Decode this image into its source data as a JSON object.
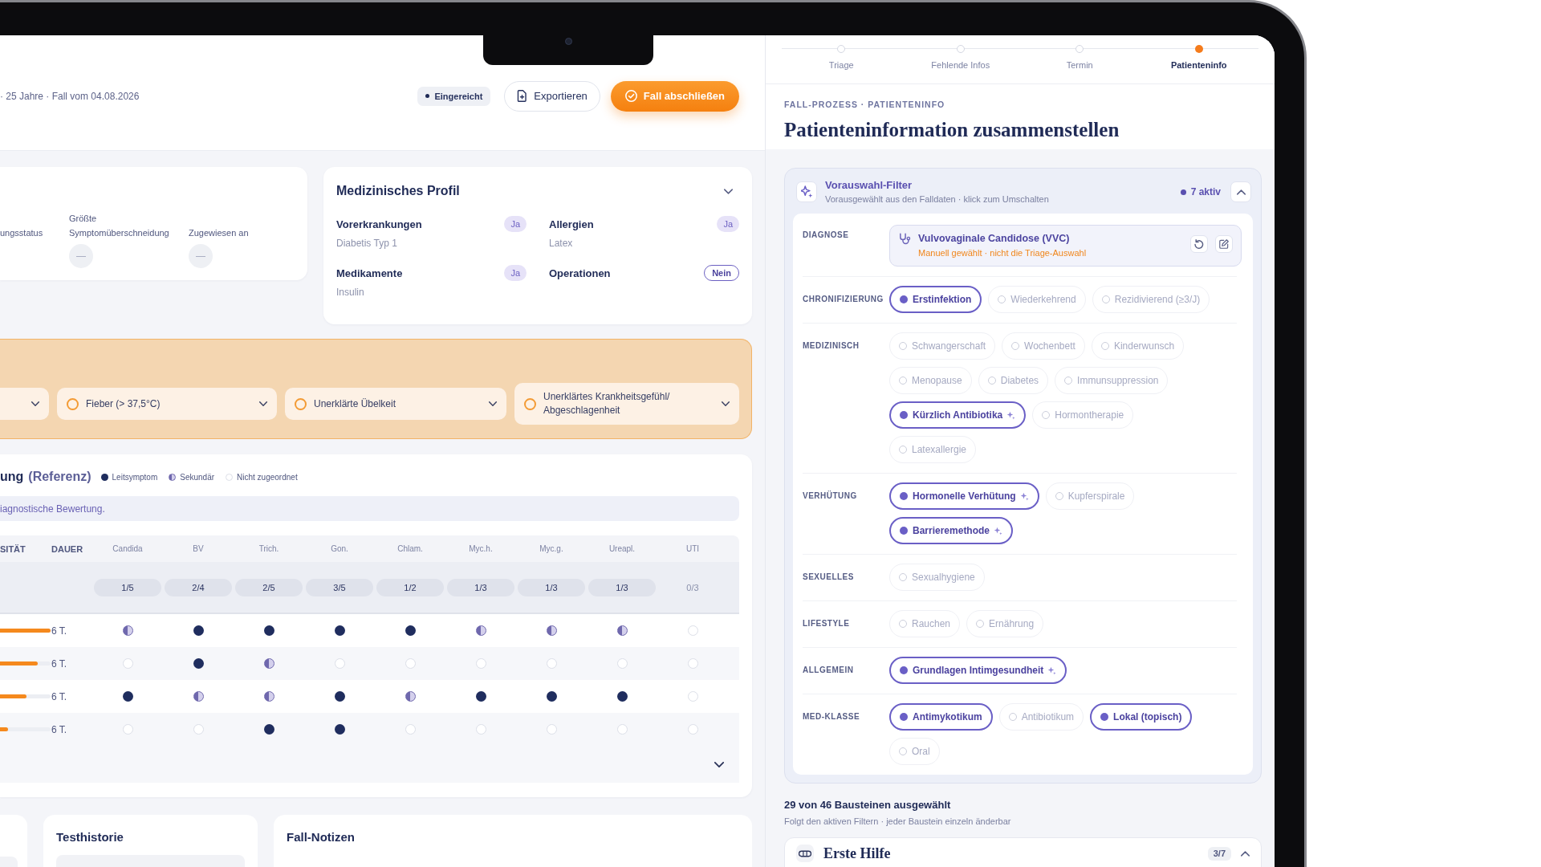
{
  "header": {
    "meta": "· 25 Jahre · Fall vom 04.08.2026",
    "status": "Eingereicht",
    "buttons": [
      {
        "label": "Exportieren",
        "kind": "secondary"
      },
      {
        "label": "Fall abschließen",
        "kind": "primary"
      }
    ]
  },
  "summary_card": {
    "fields": [
      {
        "label": "ungsstatus"
      },
      {
        "label": "Größte Symptomüberschneidung",
        "value": "—"
      },
      {
        "label": "Zugewiesen an",
        "value": "—"
      }
    ]
  },
  "profile": {
    "title": "Medizinisches Profil",
    "fields": [
      {
        "label": "Vorerkrankungen",
        "answer": "Ja",
        "kind": "yes",
        "value": "Diabetis Typ 1"
      },
      {
        "label": "Allergien",
        "answer": "Ja",
        "kind": "yes",
        "value": "Latex"
      },
      {
        "label": "Medikamente",
        "answer": "Ja",
        "kind": "yes",
        "value": "Insulin"
      },
      {
        "label": "Operationen",
        "answer": "Nein",
        "kind": "no"
      }
    ]
  },
  "symptoms": {
    "partial_dropdown": true,
    "dropdowns": [
      {
        "label": "Fieber (> 37,5°C)",
        "checked": false
      },
      {
        "label": "Unerklärte Übelkeit",
        "checked": false
      },
      {
        "label": "Unerklärtes Krankheitsgefühl/ Abgeschlagenheit",
        "checked": false
      }
    ]
  },
  "reference": {
    "title": "ung",
    "title_note": "(Referenz)",
    "legend": [
      {
        "label": "Leitsymptom",
        "kind": "lead"
      },
      {
        "label": "Sekundär",
        "kind": "secondary"
      },
      {
        "label": "Nicht zugeordnet",
        "kind": "none"
      }
    ],
    "note": "iagnostische Bewertung.",
    "columns": [
      {
        "label": "SITÄT",
        "kind": "meta"
      },
      {
        "label": "DAUER",
        "kind": "meta"
      },
      {
        "label": "Candida",
        "kind": "diagnosis"
      },
      {
        "label": "BV",
        "kind": "diagnosis"
      },
      {
        "label": "Trich.",
        "kind": "diagnosis"
      },
      {
        "label": "Gon.",
        "kind": "diagnosis"
      },
      {
        "label": "Chlam.",
        "kind": "diagnosis"
      },
      {
        "label": "Myc.h.",
        "kind": "diagnosis"
      },
      {
        "label": "Myc.g.",
        "kind": "diagnosis"
      },
      {
        "label": "Ureapl.",
        "kind": "diagnosis"
      },
      {
        "label": "UTI",
        "kind": "diagnosis"
      }
    ],
    "scores": [
      {
        "text": "1/5",
        "highlighted": true
      },
      {
        "text": "2/4",
        "highlighted": true
      },
      {
        "text": "2/5",
        "highlighted": true
      },
      {
        "text": "3/5",
        "highlighted": true
      },
      {
        "text": "1/2",
        "highlighted": true
      },
      {
        "text": "1/3",
        "highlighted": true
      },
      {
        "text": "1/3",
        "highlighted": true
      },
      {
        "text": "1/3",
        "highlighted": true
      },
      {
        "text": "0/3",
        "highlighted": false
      }
    ],
    "rows": [
      {
        "level": 1,
        "duration": "6 T.",
        "cells": [
          {
            "kind": "secondary"
          },
          {
            "kind": "lead"
          },
          {
            "kind": "lead"
          },
          {
            "kind": "lead"
          },
          {
            "kind": "lead"
          },
          {
            "kind": "secondary"
          },
          {
            "kind": "secondary"
          },
          {
            "kind": "secondary"
          },
          {
            "kind": "none"
          }
        ]
      },
      {
        "level": 0.75,
        "duration": "6 T.",
        "cells": [
          {
            "kind": "none"
          },
          {
            "kind": "lead"
          },
          {
            "kind": "secondary"
          },
          {
            "kind": "none"
          },
          {
            "kind": "none"
          },
          {
            "kind": "none"
          },
          {
            "kind": "none"
          },
          {
            "kind": "none"
          },
          {
            "kind": "none"
          }
        ]
      },
      {
        "level": 0.53,
        "duration": "6 T.",
        "cells": [
          {
            "kind": "lead"
          },
          {
            "kind": "secondary"
          },
          {
            "kind": "secondary"
          },
          {
            "kind": "lead"
          },
          {
            "kind": "secondary"
          },
          {
            "kind": "lead"
          },
          {
            "kind": "lead"
          },
          {
            "kind": "lead"
          },
          {
            "kind": "none"
          }
        ]
      },
      {
        "level": 0.16,
        "duration": "6 T.",
        "cells": [
          {
            "kind": "none"
          },
          {
            "kind": "none"
          },
          {
            "kind": "lead"
          },
          {
            "kind": "lead"
          },
          {
            "kind": "none"
          },
          {
            "kind": "none"
          },
          {
            "kind": "none"
          },
          {
            "kind": "none"
          },
          {
            "kind": "none"
          }
        ]
      }
    ]
  },
  "bottom_cards": {
    "partial_card": true,
    "cards": [
      {
        "title": "Testhistorie",
        "list": true
      },
      {
        "title": "Fall-Notizen",
        "list": false
      }
    ]
  },
  "steps": [
    {
      "label": "Triage",
      "selected": false
    },
    {
      "label": "Fehlende Infos",
      "selected": false
    },
    {
      "label": "Termin",
      "selected": false
    },
    {
      "label": "Patienteninfo",
      "selected": true
    }
  ],
  "panel": {
    "eyebrow": "FALL-PROZESS · PATIENTENINFO",
    "title": "Patienteninformation zusammenstellen"
  },
  "filter": {
    "title": "Vorauswahl-Filter",
    "subtitle": "Vorausgewählt aus den Falldaten · klick zum Umschalten",
    "active_count": "7 aktiv",
    "expanded": true,
    "diagnosis": {
      "label": "DIAGNOSE",
      "name": "Vulvovaginale Candidose (VVC)",
      "note": "Manuell gewählt · nicht die Triage-Auswahl"
    },
    "groups": [
      {
        "label": "CHRONIFIZIERUNG",
        "options": [
          {
            "label": "Erstinfektion",
            "selected": true,
            "preselected": false
          },
          {
            "label": "Wiederkehrend",
            "selected": false,
            "preselected": false
          },
          {
            "label": "Rezidivierend (≥3/J)",
            "selected": false,
            "preselected": false
          }
        ]
      },
      {
        "label": "MEDIZINISCH",
        "options": [
          {
            "label": "Schwangerschaft",
            "selected": false,
            "preselected": false
          },
          {
            "label": "Wochenbett",
            "selected": false,
            "preselected": false
          },
          {
            "label": "Kinderwunsch",
            "selected": false,
            "preselected": false
          },
          {
            "label": "Menopause",
            "selected": false,
            "preselected": false
          },
          {
            "label": "Diabetes",
            "selected": false,
            "preselected": false
          },
          {
            "label": "Immunsuppression",
            "selected": false,
            "preselected": false
          },
          {
            "label": "Kürzlich Antibiotika",
            "selected": true,
            "preselected": true
          },
          {
            "label": "Hormontherapie",
            "selected": false,
            "preselected": false
          },
          {
            "label": "Latexallergie",
            "selected": false,
            "preselected": false
          }
        ]
      },
      {
        "label": "VERHÜTUNG",
        "options": [
          {
            "label": "Hormonelle Verhütung",
            "selected": true,
            "preselected": true
          },
          {
            "label": "Kupferspirale",
            "selected": false,
            "preselected": false
          },
          {
            "label": "Barrieremethode",
            "selected": true,
            "preselected": true
          }
        ]
      },
      {
        "label": "SEXUELLES",
        "options": [
          {
            "label": "Sexualhygiene",
            "selected": false,
            "preselected": false
          }
        ]
      },
      {
        "label": "LIFESTYLE",
        "options": [
          {
            "label": "Rauchen",
            "selected": false,
            "preselected": false
          },
          {
            "label": "Ernährung",
            "selected": false,
            "preselected": false
          }
        ]
      },
      {
        "label": "ALLGEMEIN",
        "options": [
          {
            "label": "Grundlagen Intimgesundheit",
            "selected": true,
            "preselected": true
          }
        ]
      },
      {
        "label": "MED-KLASSE",
        "options": [
          {
            "label": "Antimykotikum",
            "selected": true,
            "preselected": false
          },
          {
            "label": "Antibiotikum",
            "selected": false,
            "preselected": false
          },
          {
            "label": "Lokal (topisch)",
            "selected": true,
            "preselected": false
          },
          {
            "label": "Oral",
            "selected": false,
            "preselected": false
          }
        ]
      }
    ]
  },
  "blocks": {
    "summary": "29 von 46 Bausteinen ausgewählt",
    "hint": "Folgt den aktiven Filtern · jeder Baustein einzeln änderbar",
    "sections": [
      {
        "title": "Erste Hilfe",
        "count": "3/7",
        "expanded": true
      }
    ]
  }
}
